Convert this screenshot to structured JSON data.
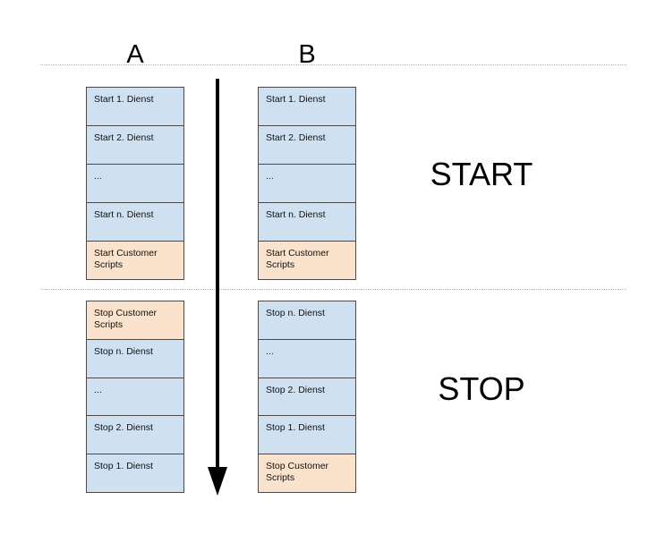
{
  "diagram": {
    "title": "Start/Stop order of services and customer scripts",
    "background_color": "#ffffff",
    "colors": {
      "service_box_fill": "#cfe0f0",
      "customer_box_fill": "#fbe2cc",
      "box_border": "#4a4a4a",
      "divider": "#b4b4b4",
      "arrow": "#000000",
      "text": "#111111"
    }
  },
  "columns": {
    "a": {
      "header": "A"
    },
    "b": {
      "header": "B"
    }
  },
  "phases": {
    "start": {
      "label": "START"
    },
    "stop": {
      "label": "STOP"
    }
  },
  "flow": {
    "arrow_direction": "down",
    "arrow_icon": "arrow-down-icon"
  },
  "start_section": {
    "column_a": [
      {
        "text": "Start 1. Dienst",
        "kind": "service"
      },
      {
        "text": "Start 2. Dienst",
        "kind": "service"
      },
      {
        "text": "...",
        "kind": "service"
      },
      {
        "text": "Start n. Dienst",
        "kind": "service"
      },
      {
        "text": "Start Customer\nScripts",
        "kind": "customer"
      }
    ],
    "column_b": [
      {
        "text": "Start 1. Dienst",
        "kind": "service"
      },
      {
        "text": "Start 2. Dienst",
        "kind": "service"
      },
      {
        "text": "...",
        "kind": "service"
      },
      {
        "text": "Start n. Dienst",
        "kind": "service"
      },
      {
        "text": "Start Customer\nScripts",
        "kind": "customer"
      }
    ]
  },
  "stop_section": {
    "column_a": [
      {
        "text": "Stop Customer\nScripts",
        "kind": "customer"
      },
      {
        "text": "Stop n. Dienst",
        "kind": "service"
      },
      {
        "text": "...",
        "kind": "service"
      },
      {
        "text": "Stop 2. Dienst",
        "kind": "service"
      },
      {
        "text": "Stop 1. Dienst",
        "kind": "service"
      }
    ],
    "column_b": [
      {
        "text": "Stop n. Dienst",
        "kind": "service"
      },
      {
        "text": "...",
        "kind": "service"
      },
      {
        "text": "Stop 2. Dienst",
        "kind": "service"
      },
      {
        "text": "Stop 1. Dienst",
        "kind": "service"
      },
      {
        "text": "Stop Customer\nScripts",
        "kind": "customer"
      }
    ]
  }
}
